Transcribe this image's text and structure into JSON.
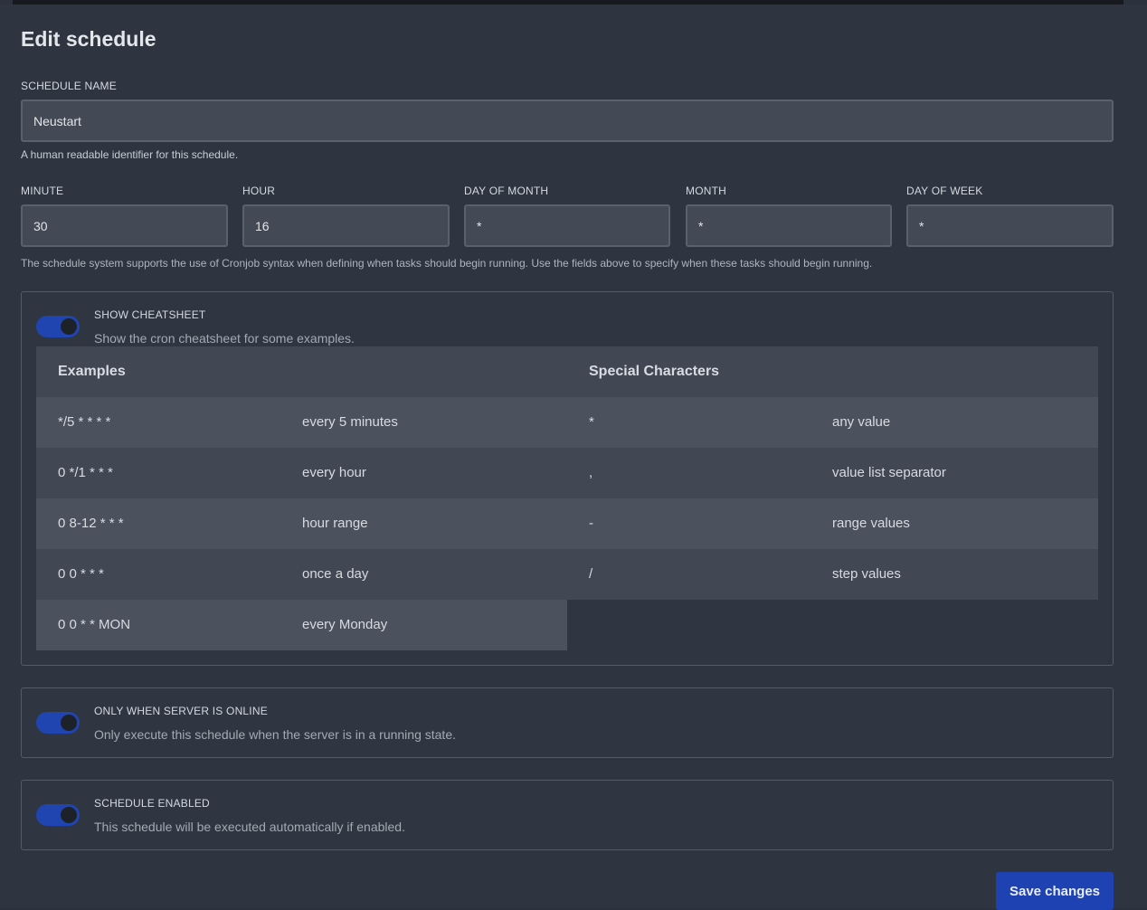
{
  "title": "Edit schedule",
  "schedule_name": {
    "label": "SCHEDULE NAME",
    "value": "Neustart",
    "help": "A human readable identifier for this schedule."
  },
  "cron": {
    "minute": {
      "label": "MINUTE",
      "value": "30"
    },
    "hour": {
      "label": "HOUR",
      "value": "16"
    },
    "day_of_month": {
      "label": "DAY OF MONTH",
      "value": "*"
    },
    "month": {
      "label": "MONTH",
      "value": "*"
    },
    "day_of_week": {
      "label": "DAY OF WEEK",
      "value": "*"
    },
    "help": "The schedule system supports the use of Cronjob syntax when defining when tasks should begin running. Use the fields above to specify when these tasks should begin running."
  },
  "cheatsheet": {
    "toggle_on": true,
    "title": "SHOW CHEATSHEET",
    "description": "Show the cron cheatsheet for some examples.",
    "examples_header": "Examples",
    "special_header": "Special Characters",
    "examples": [
      {
        "expr": "*/5 * * * *",
        "desc": "every 5 minutes"
      },
      {
        "expr": "0 */1 * * *",
        "desc": "every hour"
      },
      {
        "expr": "0 8-12 * * *",
        "desc": "hour range"
      },
      {
        "expr": "0 0 * * *",
        "desc": "once a day"
      },
      {
        "expr": "0 0 * * MON",
        "desc": "every Monday"
      }
    ],
    "special": [
      {
        "char": "*",
        "desc": "any value"
      },
      {
        "char": ",",
        "desc": "value list separator"
      },
      {
        "char": "-",
        "desc": "range values"
      },
      {
        "char": "/",
        "desc": "step values"
      }
    ]
  },
  "only_online": {
    "toggle_on": true,
    "title": "ONLY WHEN SERVER IS ONLINE",
    "description": "Only execute this schedule when the server is in a running state."
  },
  "enabled": {
    "toggle_on": true,
    "title": "SCHEDULE ENABLED",
    "description": "This schedule will be executed automatically if enabled."
  },
  "save_label": "Save changes",
  "colors": {
    "background": "#2e3540",
    "input_bg": "#434a55",
    "accent": "#1f42b2"
  }
}
